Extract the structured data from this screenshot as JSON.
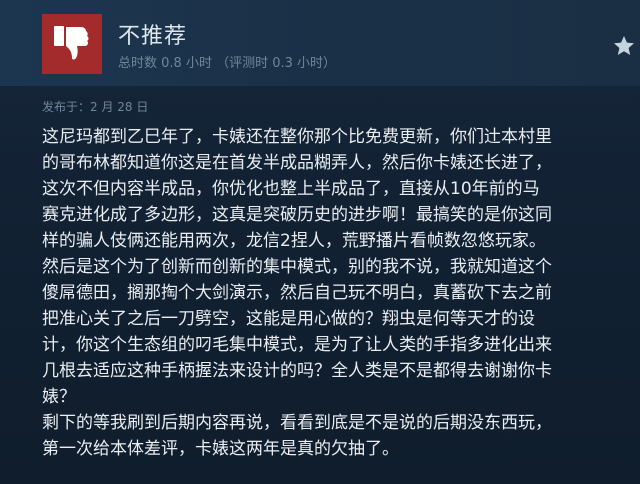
{
  "review": {
    "verdict": "不推荐",
    "playtime_text": "总时数 0.8 小时 （评测时 0.3 小时）",
    "posted": "发布于：2 月 28 日",
    "lines": [
      "这尼玛都到乙巳年了，卡婊还在整你那个比免费更新，你们辻本村里",
      "的哥布林都知道你这是在首发半成品糊弄人，然后你卡婊还长进了，",
      "这次不但内容半成品，你优化也整上半成品了，直接从10年前的马",
      "赛克进化成了多边形，这真是突破历史的进步啊！最搞笑的是你这同",
      "样的骗人伎俩还能用两次，龙信2捏人，荒野播片看帧数忽悠玩家。",
      "然后是这个为了创新而创新的集中模式，别的我不说，我就知道这个",
      "傻屌德田，搁那掏个大剑演示，然后自己玩不明白，真蓄砍下去之前",
      "把准心关了之后一刀劈空，这能是用心做的？翔虫是何等天才的设",
      "计，你这个生态组的叼毛集中模式，是为了让人类的手指多进化出来",
      "几根去适应这种手柄握法来设计的吗？全人类是不是都得去谢谢你卡",
      "婊？",
      "剩下的等我刷到后期内容再说，看看到底是不是说的后期没东西玩，",
      "第一次给本体差评，卡婊这两年是真的欠抽了。"
    ]
  },
  "icons": {
    "verdict": "thumbs-down-icon",
    "star": "star-icon"
  },
  "colors": {
    "verdict_red": "#a42b2b",
    "background": "#0f1d2c",
    "header": "#1d3650"
  }
}
